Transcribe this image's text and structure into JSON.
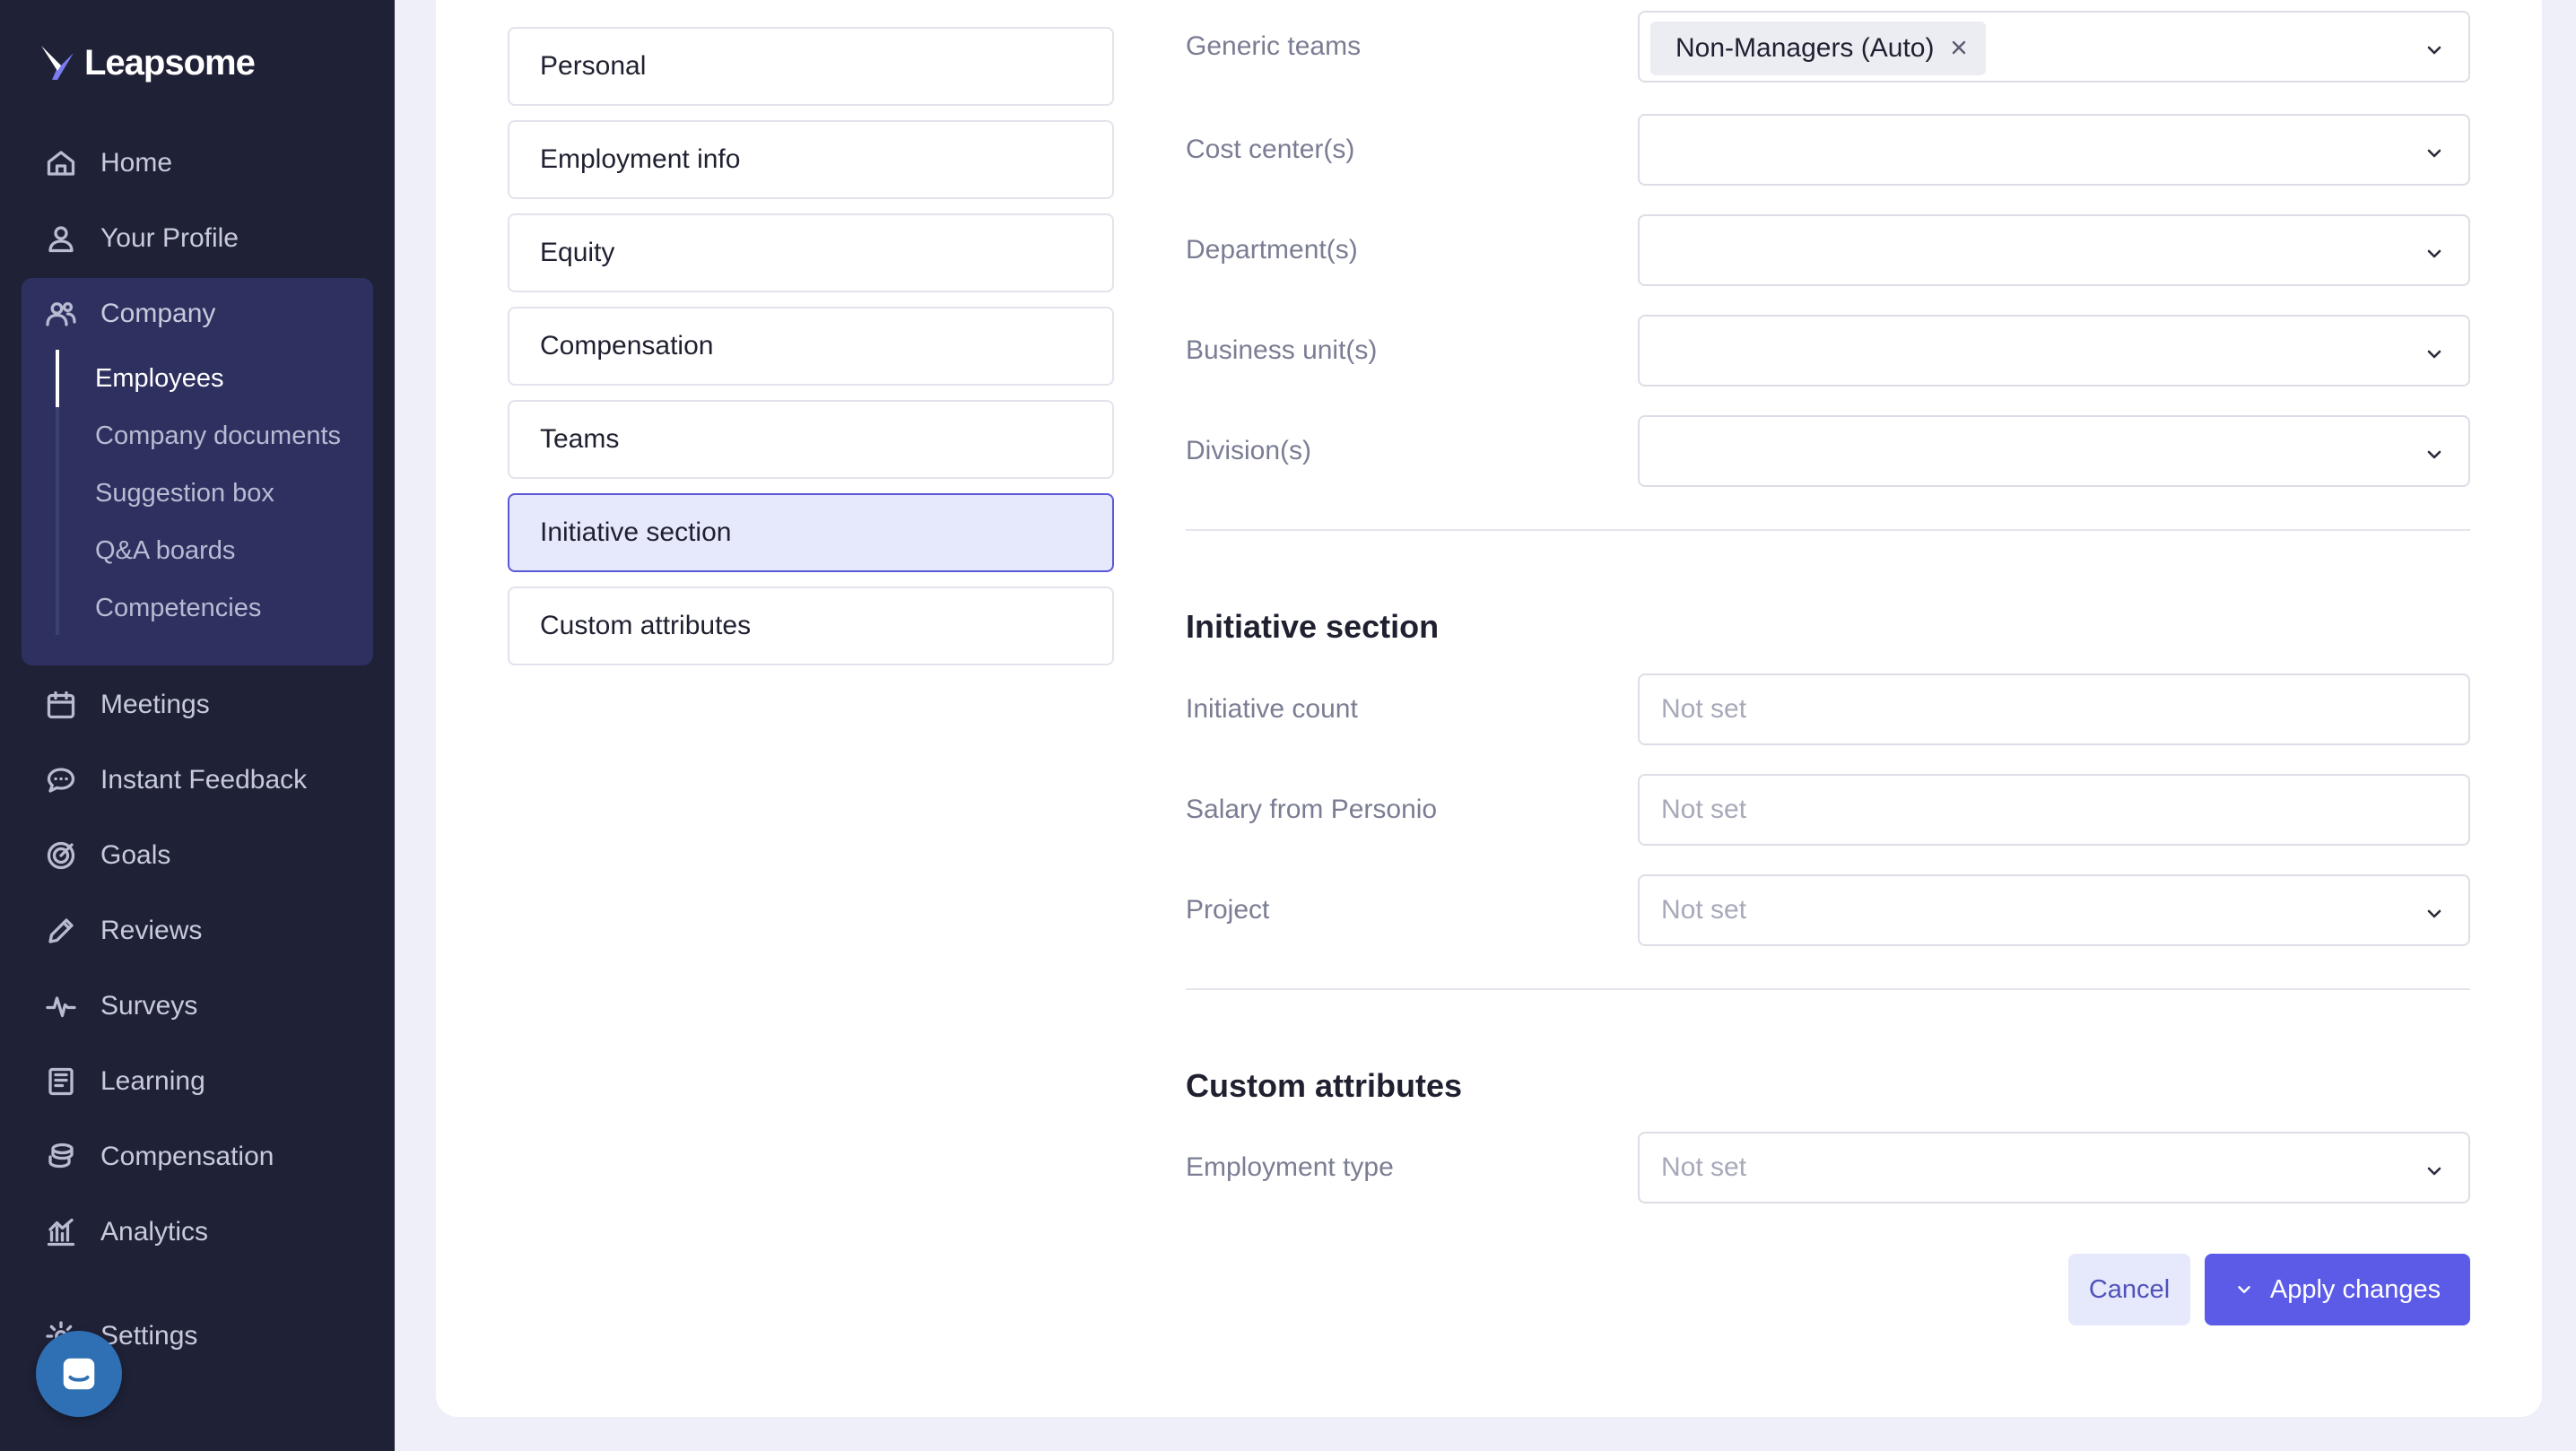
{
  "app": {
    "logo_text": "Leapsome"
  },
  "sidebar": {
    "items": [
      {
        "label": "Home",
        "icon": "home-icon"
      },
      {
        "label": "Your Profile",
        "icon": "user-icon"
      },
      {
        "label": "Company",
        "icon": "users-icon"
      },
      {
        "label": "Meetings",
        "icon": "calendar-icon"
      },
      {
        "label": "Instant Feedback",
        "icon": "chat-icon"
      },
      {
        "label": "Goals",
        "icon": "target-icon"
      },
      {
        "label": "Reviews",
        "icon": "pencil-icon"
      },
      {
        "label": "Surveys",
        "icon": "pulse-icon"
      },
      {
        "label": "Learning",
        "icon": "book-icon"
      },
      {
        "label": "Compensation",
        "icon": "coins-icon"
      },
      {
        "label": "Analytics",
        "icon": "bar-chart-icon"
      },
      {
        "label": "Settings",
        "icon": "gear-icon"
      }
    ],
    "company_sub": [
      "Employees",
      "Company documents",
      "Suggestion box",
      "Q&A boards",
      "Competencies"
    ],
    "active_sub": "Employees"
  },
  "sections": [
    "Personal",
    "Employment info",
    "Equity",
    "Compensation",
    "Teams",
    "Initiative section",
    "Custom attributes"
  ],
  "active_section": "Initiative section",
  "teams_fields": {
    "generic_teams": {
      "label": "Generic teams",
      "chip": "Non-Managers (Auto)"
    },
    "cost_centers": {
      "label": "Cost center(s)"
    },
    "departments": {
      "label": "Department(s)"
    },
    "business_units": {
      "label": "Business unit(s)"
    },
    "divisions": {
      "label": "Division(s)"
    }
  },
  "initiative": {
    "heading": "Initiative section",
    "initiative_count": {
      "label": "Initiative count",
      "placeholder": "Not set"
    },
    "salary": {
      "label": "Salary from Personio",
      "placeholder": "Not set"
    },
    "project": {
      "label": "Project",
      "value": "Not set"
    }
  },
  "custom": {
    "heading": "Custom attributes",
    "employment_type": {
      "label": "Employment type",
      "value": "Not set"
    }
  },
  "actions": {
    "cancel": "Cancel",
    "apply": "Apply changes"
  },
  "colors": {
    "sidebar_bg": "#1f2137",
    "accent": "#5b5be8",
    "active_section_bg": "#e6e8fb"
  }
}
